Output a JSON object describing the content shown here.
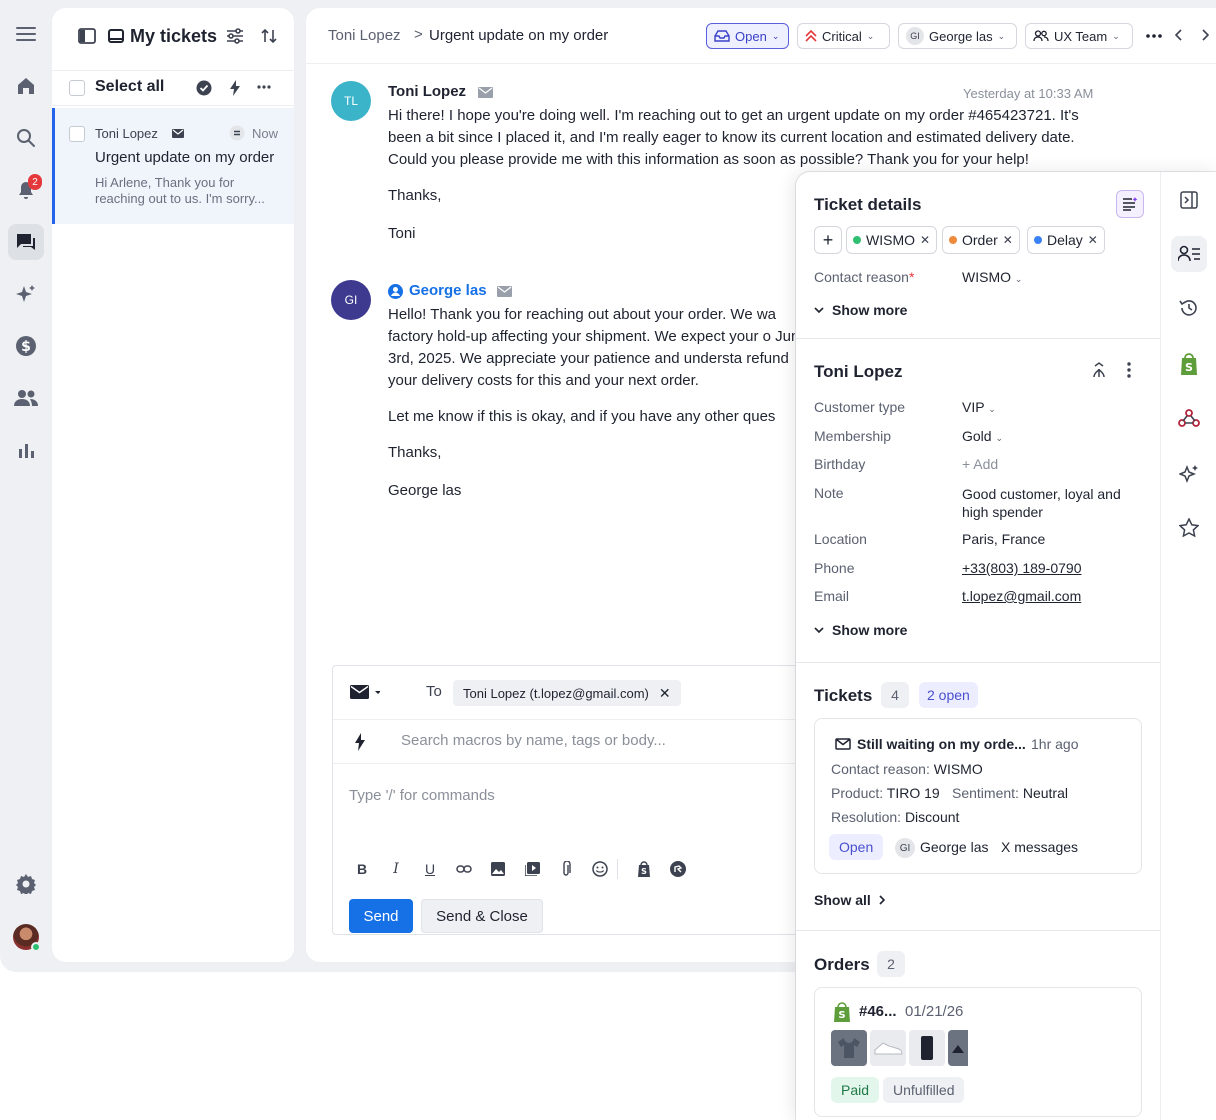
{
  "nav": {
    "notifications_count": "2"
  },
  "list": {
    "title": "My tickets",
    "select_all": "Select all",
    "ticket": {
      "customer": "Toni Lopez",
      "time": "Now",
      "subject": "Urgent update on my order",
      "preview": "Hi Arlene, Thank you for reaching out to us. I'm sorry..."
    }
  },
  "header": {
    "breadcrumb_parent": "Toni Lopez",
    "breadcrumb_sep": ">",
    "breadcrumb_current": "Urgent update on my order",
    "status": "Open",
    "priority": "Critical",
    "assignee_initials": "GI",
    "assignee": "George las",
    "team": "UX Team"
  },
  "messages": [
    {
      "initials": "TL",
      "avatar_color": "#3bb3c9",
      "author": "Toni Lopez",
      "time": "Yesterday at 10:33 AM",
      "body": "Hi there! I hope you're doing well. I'm reaching out to get an urgent update on my order #465423721. It's been a bit since I placed it, and I'm really eager to know its current location and estimated delivery date. Could you please provide me with this information as soon as possible? Thank you for your help!",
      "sign1": "Thanks,",
      "sign2": "Toni"
    },
    {
      "initials": "GI",
      "avatar_color": "#3e3a8f",
      "author": "George las",
      "body": "Hello! Thank you for reaching out about your order. We wa factory hold-up affecting your shipment. We expect your o June 3rd, 2025. We appreciate your patience and understa refund your delivery costs for this and your next order.",
      "line2": "Let me know if this is okay, and if you have any other ques",
      "sign1": "Thanks,",
      "sign2": "George las"
    }
  ],
  "composer": {
    "to_label": "To",
    "to_recipient": "Toni Lopez (t.lopez@gmail.com)",
    "macro_placeholder": "Search macros by name, tags or body...",
    "body_placeholder": "Type '/' for commands",
    "send": "Send",
    "send_close": "Send & Close"
  },
  "details": {
    "title": "Ticket details",
    "tags": [
      {
        "label": "WISMO",
        "color": "#2fbf71"
      },
      {
        "label": "Order",
        "color": "#f08a3c"
      },
      {
        "label": "Delay",
        "color": "#3b82f6"
      }
    ],
    "contact_reason_label": "Contact reason",
    "contact_reason_required": "*",
    "contact_reason": "WISMO",
    "show_more": "Show more"
  },
  "customer": {
    "name": "Toni Lopez",
    "fields": [
      {
        "label": "Customer type",
        "value": "VIP"
      },
      {
        "label": "Membership",
        "value": "Gold"
      },
      {
        "label": "Birthday",
        "value": "+ Add"
      },
      {
        "label": "Note",
        "value": "Good customer, loyal and high spender"
      },
      {
        "label": "Location",
        "value": "Paris, France"
      },
      {
        "label": "Phone",
        "value": "+33(803) 189-0790"
      },
      {
        "label": "Email",
        "value": "t.lopez@gmail.com"
      }
    ],
    "show_more": "Show more"
  },
  "tickets": {
    "title": "Tickets",
    "count": "4",
    "open_count": "2 open",
    "card": {
      "subject": "Still waiting on my orde...",
      "time": "1hr ago",
      "contact_reason_label": "Contact reason:",
      "contact_reason": "WISMO",
      "product_label": "Product:",
      "product": "TIRO 19",
      "sentiment_label": "Sentiment:",
      "sentiment": "Neutral",
      "resolution_label": "Resolution:",
      "resolution": "Discount",
      "status": "Open",
      "agent_initials": "GI",
      "agent": "George las",
      "messages": "X messages"
    },
    "show_all": "Show all"
  },
  "orders": {
    "title": "Orders",
    "count": "2",
    "order": {
      "number": "#46...",
      "date": "01/21/26",
      "paid": "Paid",
      "fulfillment": "Unfulfilled"
    }
  }
}
